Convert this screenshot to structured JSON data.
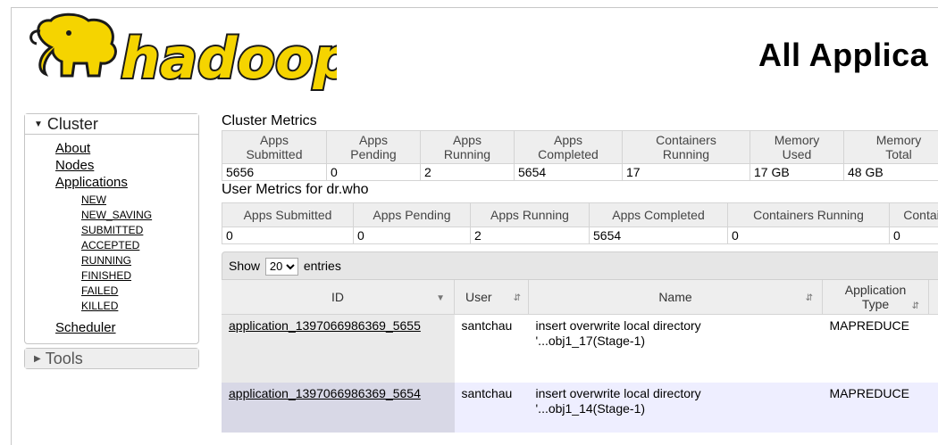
{
  "header": {
    "logo_text": "hadoop",
    "page_title": "All Applica"
  },
  "sidebar": {
    "cluster_label": "Cluster",
    "links": [
      "About",
      "Nodes",
      "Applications"
    ],
    "app_states": [
      "NEW",
      "NEW_SAVING",
      "SUBMITTED",
      "ACCEPTED",
      "RUNNING",
      "FINISHED",
      "FAILED",
      "KILLED"
    ],
    "scheduler_label": "Scheduler",
    "tools_label": "Tools"
  },
  "cluster_metrics": {
    "title": "Cluster Metrics",
    "headers": [
      [
        "Apps",
        "Submitted"
      ],
      [
        "Apps",
        "Pending"
      ],
      [
        "Apps",
        "Running"
      ],
      [
        "Apps",
        "Completed"
      ],
      [
        "Containers",
        "Running"
      ],
      [
        "Memory",
        "Used"
      ],
      [
        "Memory",
        "Total"
      ]
    ],
    "values": [
      "5656",
      "0",
      "2",
      "5654",
      "17",
      "17 GB",
      "48 GB"
    ]
  },
  "user_metrics": {
    "title": "User Metrics for dr.who",
    "headers": [
      "Apps Submitted",
      "Apps Pending",
      "Apps Running",
      "Apps Completed",
      "Containers Running",
      "Contai"
    ],
    "values": [
      "0",
      "0",
      "2",
      "5654",
      "0",
      "0"
    ]
  },
  "apps_table": {
    "show_label": "Show",
    "entries_label": "entries",
    "page_size": "20",
    "columns": {
      "id": "ID",
      "user": "User",
      "name": "Name",
      "type_line1": "Application",
      "type_line2": "Type"
    },
    "rows": [
      {
        "id": "application_1397066986369_5655",
        "user": "santchau",
        "name_line1": "insert overwrite local directory",
        "name_line2": "'...obj1_17(Stage-1)",
        "type": "MAPREDUCE"
      },
      {
        "id": "application_1397066986369_5654",
        "user": "santchau",
        "name_line1": "insert overwrite local directory",
        "name_line2": "'...obj1_14(Stage-1)",
        "type": "MAPREDUCE"
      }
    ]
  },
  "colors": {
    "logo_yellow": "#f5d400",
    "logo_outline": "#1a1a1a",
    "row_alt": "#eeeeff"
  }
}
